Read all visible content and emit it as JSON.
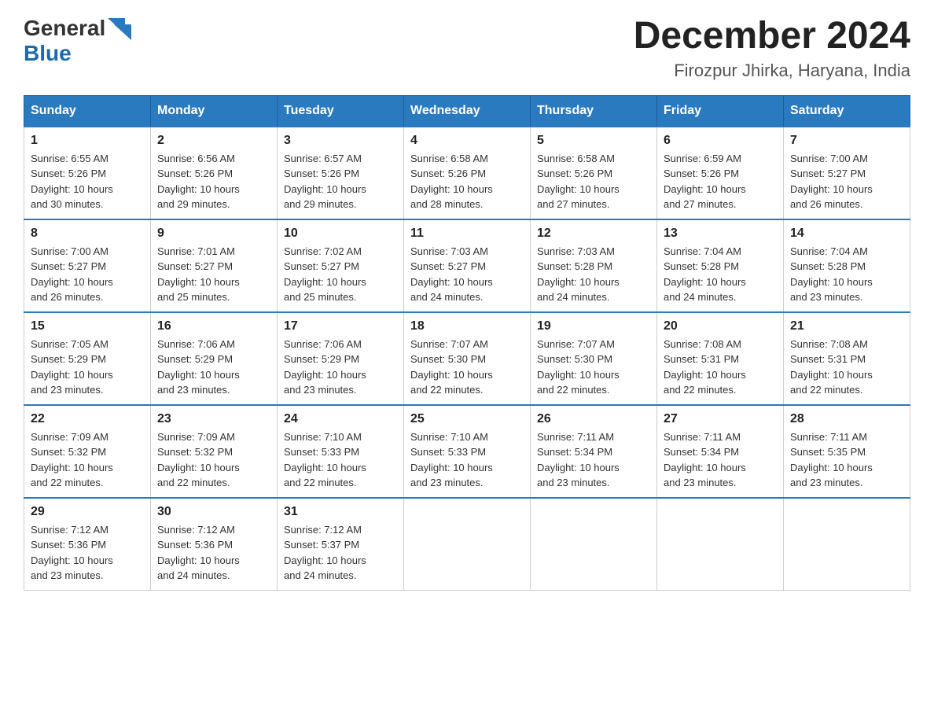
{
  "header": {
    "logo_general": "General",
    "logo_blue": "Blue",
    "month_year": "December 2024",
    "location": "Firozpur Jhirka, Haryana, India"
  },
  "days_of_week": [
    "Sunday",
    "Monday",
    "Tuesday",
    "Wednesday",
    "Thursday",
    "Friday",
    "Saturday"
  ],
  "weeks": [
    [
      {
        "day": "1",
        "sunrise": "6:55 AM",
        "sunset": "5:26 PM",
        "daylight": "10 hours and 30 minutes."
      },
      {
        "day": "2",
        "sunrise": "6:56 AM",
        "sunset": "5:26 PM",
        "daylight": "10 hours and 29 minutes."
      },
      {
        "day": "3",
        "sunrise": "6:57 AM",
        "sunset": "5:26 PM",
        "daylight": "10 hours and 29 minutes."
      },
      {
        "day": "4",
        "sunrise": "6:58 AM",
        "sunset": "5:26 PM",
        "daylight": "10 hours and 28 minutes."
      },
      {
        "day": "5",
        "sunrise": "6:58 AM",
        "sunset": "5:26 PM",
        "daylight": "10 hours and 27 minutes."
      },
      {
        "day": "6",
        "sunrise": "6:59 AM",
        "sunset": "5:26 PM",
        "daylight": "10 hours and 27 minutes."
      },
      {
        "day": "7",
        "sunrise": "7:00 AM",
        "sunset": "5:27 PM",
        "daylight": "10 hours and 26 minutes."
      }
    ],
    [
      {
        "day": "8",
        "sunrise": "7:00 AM",
        "sunset": "5:27 PM",
        "daylight": "10 hours and 26 minutes."
      },
      {
        "day": "9",
        "sunrise": "7:01 AM",
        "sunset": "5:27 PM",
        "daylight": "10 hours and 25 minutes."
      },
      {
        "day": "10",
        "sunrise": "7:02 AM",
        "sunset": "5:27 PM",
        "daylight": "10 hours and 25 minutes."
      },
      {
        "day": "11",
        "sunrise": "7:03 AM",
        "sunset": "5:27 PM",
        "daylight": "10 hours and 24 minutes."
      },
      {
        "day": "12",
        "sunrise": "7:03 AM",
        "sunset": "5:28 PM",
        "daylight": "10 hours and 24 minutes."
      },
      {
        "day": "13",
        "sunrise": "7:04 AM",
        "sunset": "5:28 PM",
        "daylight": "10 hours and 24 minutes."
      },
      {
        "day": "14",
        "sunrise": "7:04 AM",
        "sunset": "5:28 PM",
        "daylight": "10 hours and 23 minutes."
      }
    ],
    [
      {
        "day": "15",
        "sunrise": "7:05 AM",
        "sunset": "5:29 PM",
        "daylight": "10 hours and 23 minutes."
      },
      {
        "day": "16",
        "sunrise": "7:06 AM",
        "sunset": "5:29 PM",
        "daylight": "10 hours and 23 minutes."
      },
      {
        "day": "17",
        "sunrise": "7:06 AM",
        "sunset": "5:29 PM",
        "daylight": "10 hours and 23 minutes."
      },
      {
        "day": "18",
        "sunrise": "7:07 AM",
        "sunset": "5:30 PM",
        "daylight": "10 hours and 22 minutes."
      },
      {
        "day": "19",
        "sunrise": "7:07 AM",
        "sunset": "5:30 PM",
        "daylight": "10 hours and 22 minutes."
      },
      {
        "day": "20",
        "sunrise": "7:08 AM",
        "sunset": "5:31 PM",
        "daylight": "10 hours and 22 minutes."
      },
      {
        "day": "21",
        "sunrise": "7:08 AM",
        "sunset": "5:31 PM",
        "daylight": "10 hours and 22 minutes."
      }
    ],
    [
      {
        "day": "22",
        "sunrise": "7:09 AM",
        "sunset": "5:32 PM",
        "daylight": "10 hours and 22 minutes."
      },
      {
        "day": "23",
        "sunrise": "7:09 AM",
        "sunset": "5:32 PM",
        "daylight": "10 hours and 22 minutes."
      },
      {
        "day": "24",
        "sunrise": "7:10 AM",
        "sunset": "5:33 PM",
        "daylight": "10 hours and 22 minutes."
      },
      {
        "day": "25",
        "sunrise": "7:10 AM",
        "sunset": "5:33 PM",
        "daylight": "10 hours and 23 minutes."
      },
      {
        "day": "26",
        "sunrise": "7:11 AM",
        "sunset": "5:34 PM",
        "daylight": "10 hours and 23 minutes."
      },
      {
        "day": "27",
        "sunrise": "7:11 AM",
        "sunset": "5:34 PM",
        "daylight": "10 hours and 23 minutes."
      },
      {
        "day": "28",
        "sunrise": "7:11 AM",
        "sunset": "5:35 PM",
        "daylight": "10 hours and 23 minutes."
      }
    ],
    [
      {
        "day": "29",
        "sunrise": "7:12 AM",
        "sunset": "5:36 PM",
        "daylight": "10 hours and 23 minutes."
      },
      {
        "day": "30",
        "sunrise": "7:12 AM",
        "sunset": "5:36 PM",
        "daylight": "10 hours and 24 minutes."
      },
      {
        "day": "31",
        "sunrise": "7:12 AM",
        "sunset": "5:37 PM",
        "daylight": "10 hours and 24 minutes."
      },
      null,
      null,
      null,
      null
    ]
  ],
  "labels": {
    "sunrise": "Sunrise:",
    "sunset": "Sunset:",
    "daylight": "Daylight:"
  },
  "colors": {
    "header_bg": "#2a7abf",
    "header_border": "#1e5f96",
    "row_top_border": "#2a7abf"
  }
}
